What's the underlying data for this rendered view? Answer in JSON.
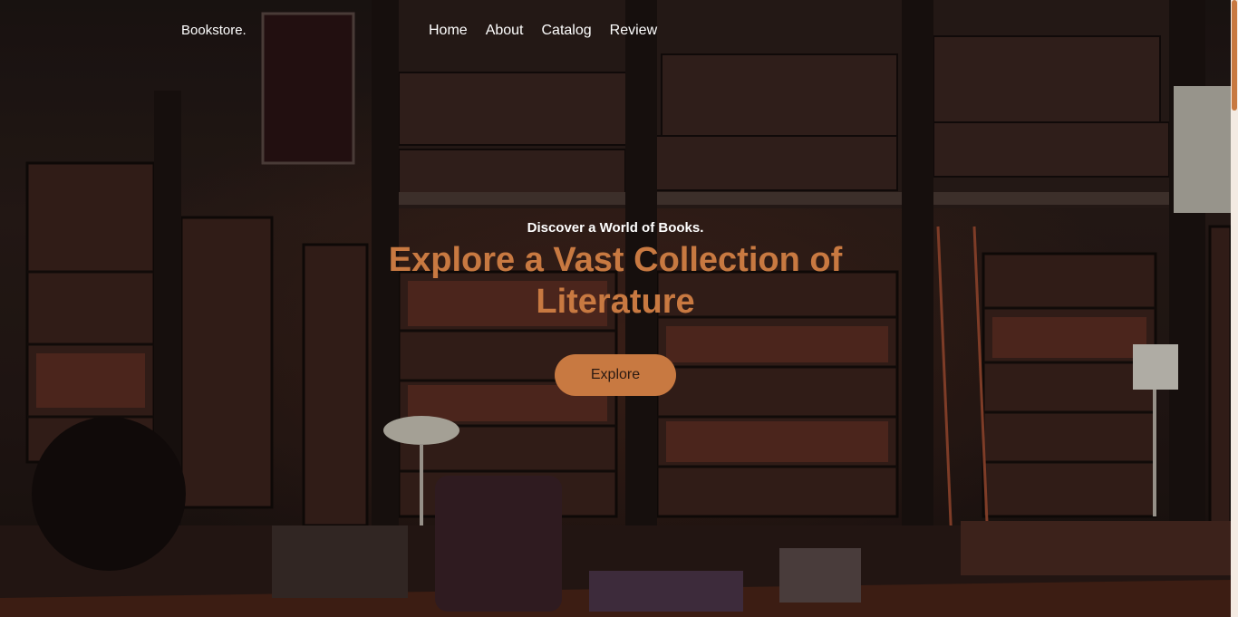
{
  "nav": {
    "logo": "Bookstore.",
    "links": [
      "Home",
      "About",
      "Catalog",
      "Review"
    ]
  },
  "hero": {
    "subtitle": "Discover a World of Books.",
    "title": "Explore a Vast Collection of Literature",
    "cta_label": "Explore",
    "background": "library-interior-image"
  },
  "colors": {
    "accent": "#c87941",
    "text_light": "#ffffff",
    "page_bg": "#f4ebe3"
  }
}
